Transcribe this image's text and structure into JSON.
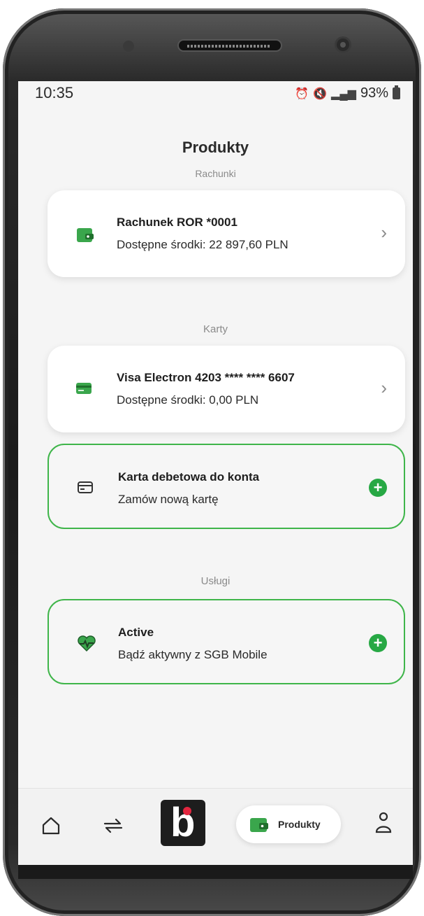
{
  "status": {
    "time": "10:35",
    "battery": "93%"
  },
  "page": {
    "title": "Produkty"
  },
  "sections": {
    "accounts_label": "Rachunki",
    "cards_label": "Karty",
    "services_label": "Usługi"
  },
  "accounts": [
    {
      "title": "Rachunek ROR *0001",
      "subtitle": "Dostępne środki: 22 897,60 PLN"
    }
  ],
  "cards": [
    {
      "title": "Visa Electron 4203 **** **** 6607",
      "subtitle": "Dostępne środki: 0,00 PLN"
    }
  ],
  "add_card": {
    "title": "Karta debetowa do konta",
    "subtitle": "Zamów nową kartę"
  },
  "services": [
    {
      "title": "Active",
      "subtitle": "Bądź aktywny z SGB Mobile"
    }
  ],
  "nav": {
    "products_label": "Produkty",
    "logo_letter": "b"
  },
  "colors": {
    "accent_green": "#27a844",
    "border_green": "#3fb54a",
    "logo_red": "#e3263f"
  }
}
